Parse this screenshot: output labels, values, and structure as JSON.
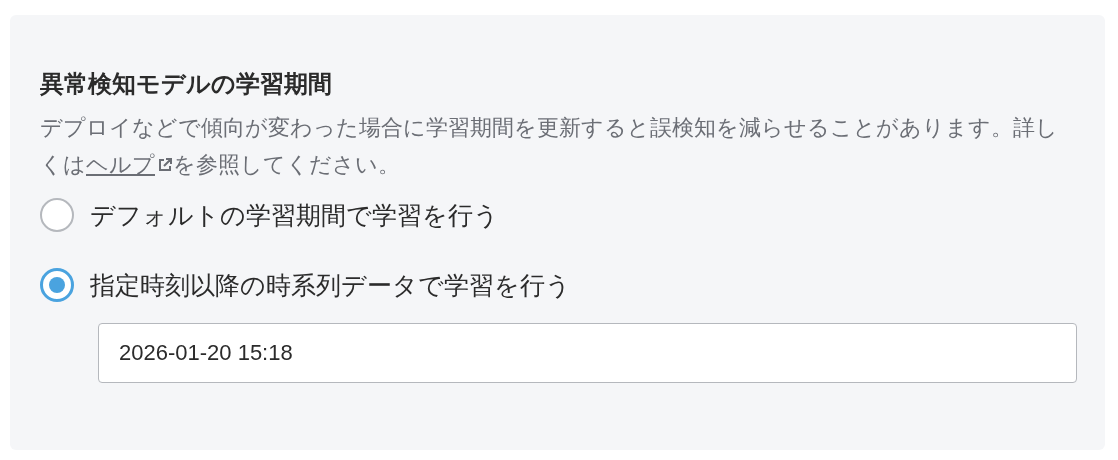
{
  "section": {
    "title": "異常検知モデルの学習期間",
    "description": {
      "before": "デプロイなどで傾向が変わった場合に学習期間を更新すると誤検知を減らせることがあります。詳しくは",
      "link": "ヘルプ",
      "after": "を参照してください。"
    },
    "options": [
      {
        "label": "デフォルトの学習期間で学習を行う",
        "selected": false
      },
      {
        "label": "指定時刻以降の時系列データで学習を行う",
        "selected": true
      }
    ],
    "datetime_field": {
      "value": "2026-01-20 15:18"
    }
  }
}
